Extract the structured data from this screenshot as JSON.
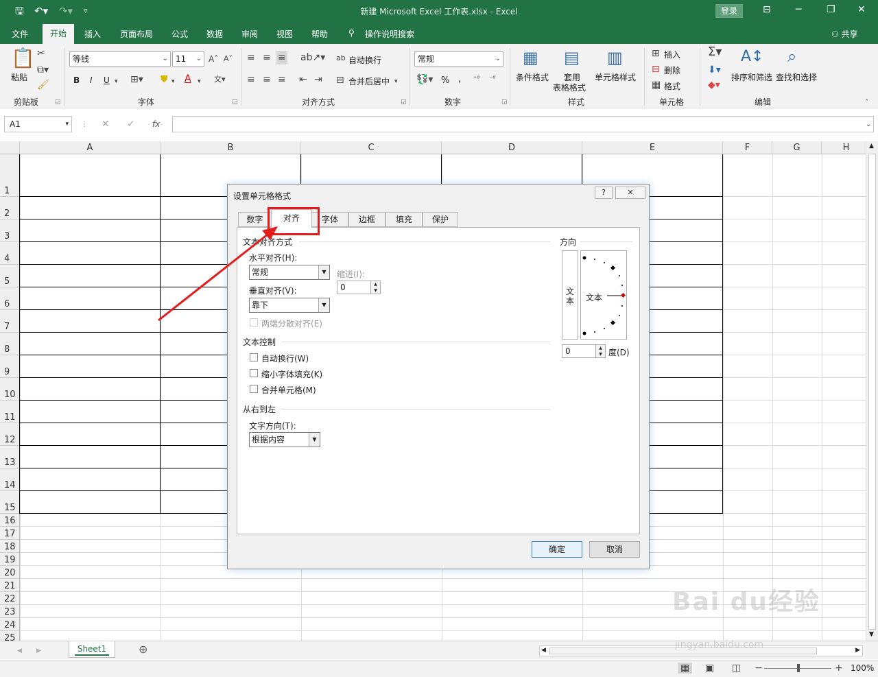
{
  "window": {
    "doc_title": "新建 Microsoft Excel 工作表.xlsx  -  Excel",
    "login": "登录"
  },
  "ribbon_tabs": [
    "文件",
    "开始",
    "插入",
    "页面布局",
    "公式",
    "数据",
    "审阅",
    "视图",
    "帮助",
    "操作说明搜索"
  ],
  "share": "共享",
  "ribbon": {
    "paste": "粘贴",
    "clipboard": "剪贴板",
    "font_name": "等线",
    "font_size": "11",
    "font_group": "字体",
    "bold": "B",
    "italic": "I",
    "underline": "U",
    "wrap_text": "自动换行",
    "merge_center": "合并后居中",
    "align_group": "对齐方式",
    "number_format": "常规",
    "percent": "%",
    "comma": ",",
    "number_group": "数字",
    "cond_format": "条件格式",
    "table_format_1": "套用",
    "table_format_2": "表格格式",
    "cell_style": "单元格样式",
    "style_group": "样式",
    "insert": "插入",
    "delete": "删除",
    "format": "格式",
    "cells_group": "单元格",
    "sort_filter": "排序和筛选",
    "find_select": "查找和选择",
    "edit_group": "编辑"
  },
  "formula_bar": {
    "name_box": "A1",
    "fx": "fx",
    "value": ""
  },
  "columns": [
    "A",
    "B",
    "C",
    "D",
    "E",
    "F",
    "G",
    "H"
  ],
  "rows": [
    "1",
    "2",
    "3",
    "4",
    "5",
    "6",
    "7",
    "8",
    "9",
    "10",
    "11",
    "12",
    "13",
    "14",
    "15",
    "16",
    "17",
    "18",
    "19",
    "20",
    "21",
    "22",
    "23",
    "24",
    "25"
  ],
  "sheet_tab": "Sheet1",
  "zoom": "100%",
  "dialog": {
    "title": "设置单元格格式",
    "help": "?",
    "close": "✕",
    "tabs": [
      "数字",
      "对齐",
      "字体",
      "边框",
      "填充",
      "保护"
    ],
    "selected_tab": "对齐",
    "text_align_section": "文本对齐方式",
    "horizontal_label": "水平对齐(H):",
    "horizontal_value": "常规",
    "indent_label": "缩进(I):",
    "indent_value": "0",
    "vertical_label": "垂直对齐(V):",
    "vertical_value": "靠下",
    "justify_distributed": "两端分散对齐(E)",
    "text_control_section": "文本控制",
    "wrap_text": "自动换行(W)",
    "shrink_to_fit": "缩小字体填充(K)",
    "merge_cells": "合并单元格(M)",
    "rtl_section": "从右到左",
    "text_direction_label": "文字方向(T):",
    "text_direction_value": "根据内容",
    "orientation_section": "方向",
    "orientation_vertical_text": "文本",
    "orientation_text": "文本",
    "degree_value": "0",
    "degree_label": "度(D)",
    "ok": "确定",
    "cancel": "取消"
  },
  "watermark": {
    "logo": "Bai du经验",
    "url": "jingyan.baidu.com"
  },
  "colors": {
    "excel_green": "#217346",
    "highlight_red": "#e31b1b"
  }
}
